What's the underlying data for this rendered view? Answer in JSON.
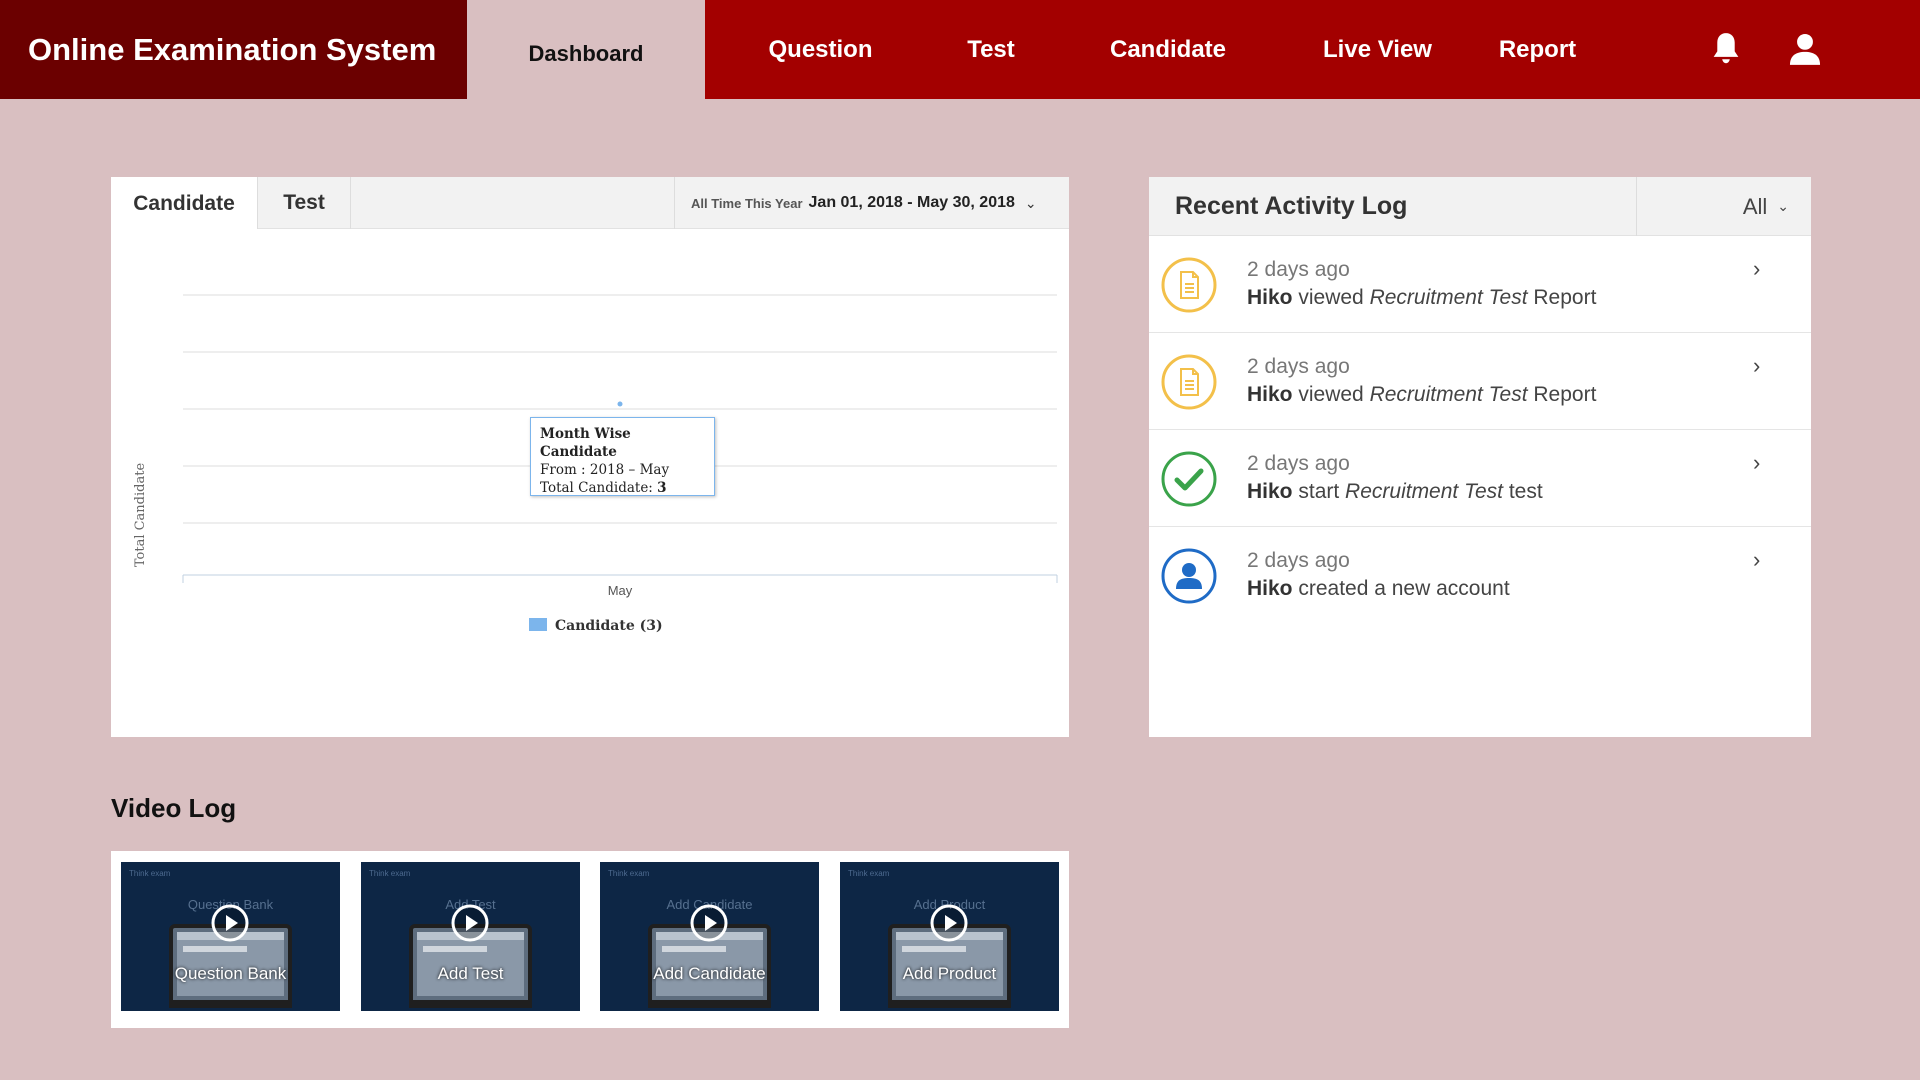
{
  "header": {
    "app_title": "Online Examination System",
    "nav": [
      {
        "label": "Dashboard",
        "active": true
      },
      {
        "label": "Question"
      },
      {
        "label": "Test"
      },
      {
        "label": "Candidate"
      },
      {
        "label": "Live View"
      },
      {
        "label": "Report"
      }
    ],
    "icons": [
      "bell-icon",
      "user-icon"
    ]
  },
  "chart_panel": {
    "tabs": [
      {
        "label": "Candidate",
        "active": true
      },
      {
        "label": "Test"
      }
    ],
    "date_presets": "All Time This Year",
    "date_range": "Jan 01, 2018 - May 30, 2018",
    "tooltip": {
      "title": "Month Wise Candidate",
      "from_label": "From :",
      "from_value": "2018 – May",
      "total_label": "Total Candidate:",
      "total_value": "3"
    }
  },
  "chart_data": {
    "type": "line",
    "categories": [
      "May"
    ],
    "series": [
      {
        "name": "Candidate (3)",
        "values": [
          3
        ]
      }
    ],
    "ylabel": "Total Candidate",
    "grid": true,
    "legend_position": "bottom",
    "series_color": "#7cb5ec"
  },
  "activity": {
    "title": "Recent Activity Log",
    "filter": "All",
    "items": [
      {
        "icon": "document-icon",
        "time": "2 days ago",
        "user": "Hiko",
        "verb": "viewed",
        "object": "Recruitment Test",
        "suffix": "Report"
      },
      {
        "icon": "document-icon",
        "time": "2 days ago",
        "user": "Hiko",
        "verb": "viewed",
        "object": "Recruitment Test",
        "suffix": "Report"
      },
      {
        "icon": "check-circle-icon",
        "time": "2 days ago",
        "user": "Hiko",
        "verb": "start",
        "object": "Recruitment Test",
        "suffix": "test"
      },
      {
        "icon": "user-circle-icon",
        "time": "2 days ago",
        "user": "Hiko",
        "verb": "created a new account",
        "object": "",
        "suffix": ""
      }
    ]
  },
  "video_log": {
    "title": "Video Log",
    "videos": [
      {
        "label": "Question Bank",
        "ghost": "Question Bank"
      },
      {
        "label": "Add Test",
        "ghost": "Add Test"
      },
      {
        "label": "Add Candidate",
        "ghost": "Add Candidate"
      },
      {
        "label": "Add Product",
        "ghost": "Add Product"
      }
    ],
    "card_tag": "Think exam"
  },
  "colors": {
    "header_red": "#a30000",
    "brand_dark_red": "#6b0000",
    "page_bg": "#d9bfc1",
    "doc_icon": "#f3c04a",
    "check_icon": "#3aa34a",
    "user_icon": "#1f6bc6"
  }
}
